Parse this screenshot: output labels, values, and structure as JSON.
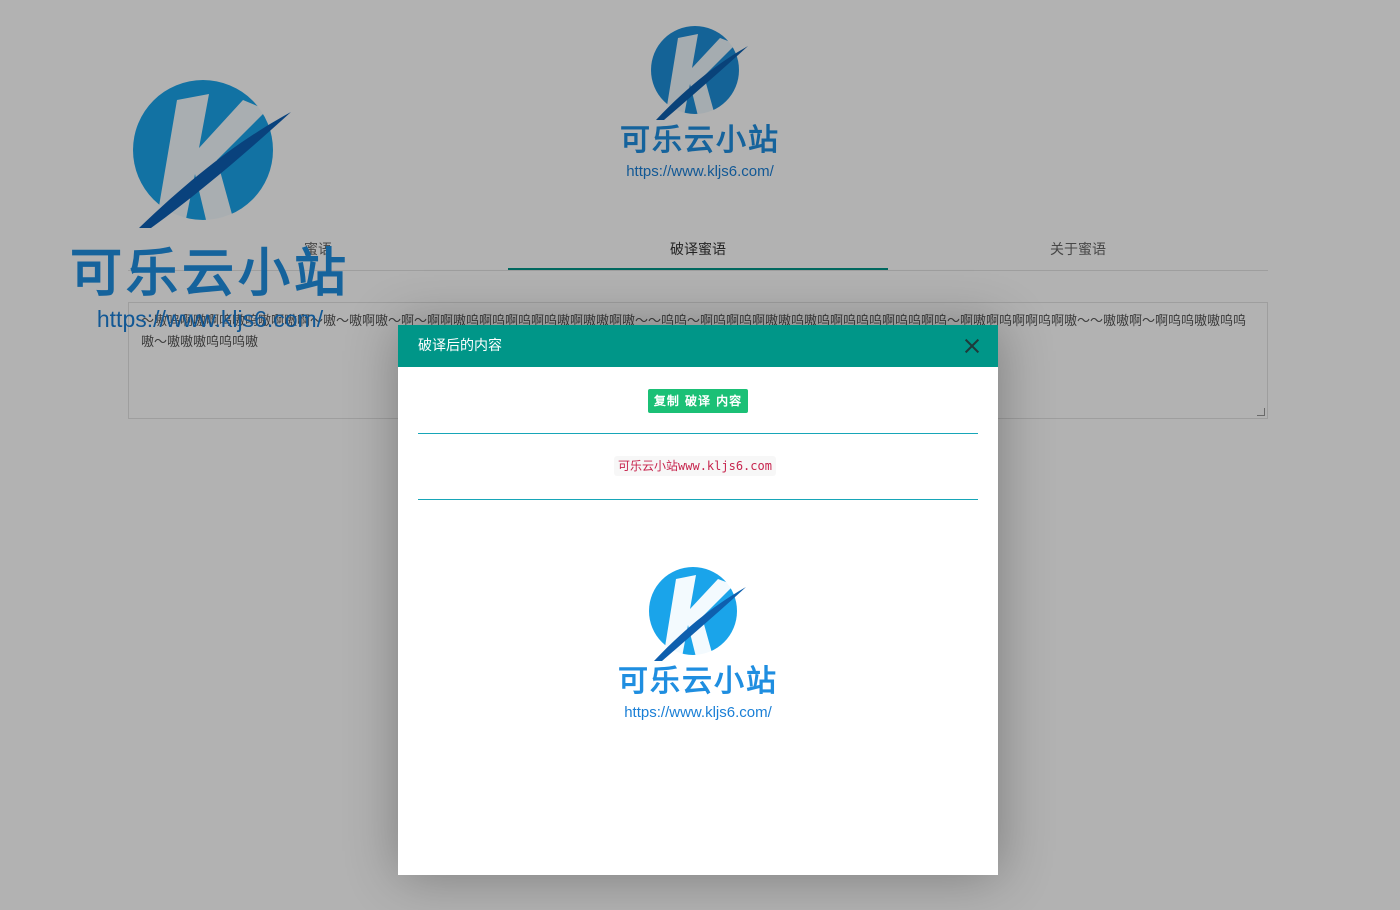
{
  "brand": {
    "name": "可乐云小站",
    "url": "https://www.kljs6.com/",
    "primary_color": "#1f8ee0",
    "accent_color": "#009688"
  },
  "tabs": [
    {
      "label": "蜜语",
      "active": false
    },
    {
      "label": "破译蜜语",
      "active": true
    },
    {
      "label": "关于蜜语",
      "active": false
    }
  ],
  "cipher_text": "～嗷呜啊嗷啊呜嗷呜嗷啊嗷啊～嗷～嗷啊嗷～啊～啊啊嗷呜啊呜啊呜啊呜嗷啊嗷嗷啊嗷～～呜呜～啊呜啊呜啊嗷嗷呜嗷呜啊呜呜呜啊呜呜啊呜～啊嗷啊呜啊啊呜啊嗷～～嗷嗷啊～啊呜呜嗷嗷呜呜嗷～嗷嗷嗷呜呜呜嗷",
  "modal": {
    "title": "破译后的内容",
    "copy_button": "复制 破译 内容",
    "result_cn": "可乐云小站",
    "result_url": "www.kljs6.com"
  }
}
